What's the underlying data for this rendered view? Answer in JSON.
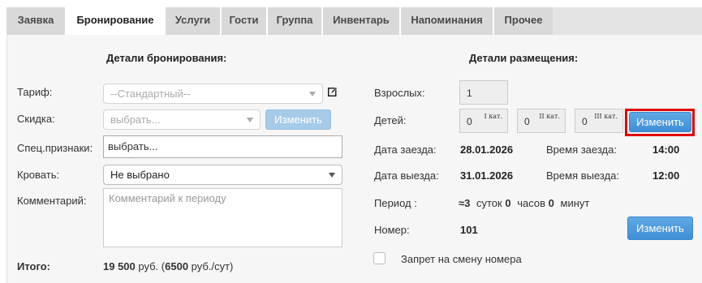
{
  "tabs": [
    "Заявка",
    "Бронирование",
    "Услуги",
    "Гости",
    "Группа",
    "Инвентарь",
    "Напоминания",
    "Прочее"
  ],
  "active_tab": "Бронирование",
  "left": {
    "heading": "Детали бронирования:",
    "tariff_label": "Тариф:",
    "tariff_value": "--Стандартный--",
    "discount_label": "Скидка:",
    "discount_value": "выбрать...",
    "discount_button": "Изменить",
    "special_label": "Спец.признаки:",
    "special_value": "выбрать...",
    "bed_label": "Кровать:",
    "bed_value": "Не выбрано",
    "comment_label": "Комментарий:",
    "comment_placeholder": "Комментарий к периоду",
    "total_label": "Итого:",
    "total_amount": "19 500",
    "total_currency": "руб. (",
    "total_daily": "6500",
    "total_daily_unit": "руб./сут)"
  },
  "right": {
    "heading": "Детали размещения:",
    "adults_label": "Взрослых:",
    "adults_value": "1",
    "children_label": "Детей:",
    "children": [
      {
        "value": "0",
        "cat": "I кат."
      },
      {
        "value": "0",
        "cat": "II кат."
      },
      {
        "value": "0",
        "cat": "III кат."
      }
    ],
    "children_button": "Изменить",
    "checkin_label": "Дата заезда:",
    "checkin_date": "28.01.2026",
    "checkin_time_label": "Время заезда:",
    "checkin_time": "14:00",
    "checkout_label": "Дата выезда:",
    "checkout_date": "31.01.2026",
    "checkout_time_label": "Время выезда:",
    "checkout_time": "12:00",
    "period_label": "Период :",
    "period_approx": "≈3",
    "period_days_unit": "суток",
    "period_hours": "0",
    "period_hours_unit": "часов",
    "period_minutes": "0",
    "period_minutes_unit": "минут",
    "room_label": "Номер:",
    "room_value": "101",
    "room_button": "Изменить",
    "no_change_room_label": "Запрет на смену номера"
  }
}
